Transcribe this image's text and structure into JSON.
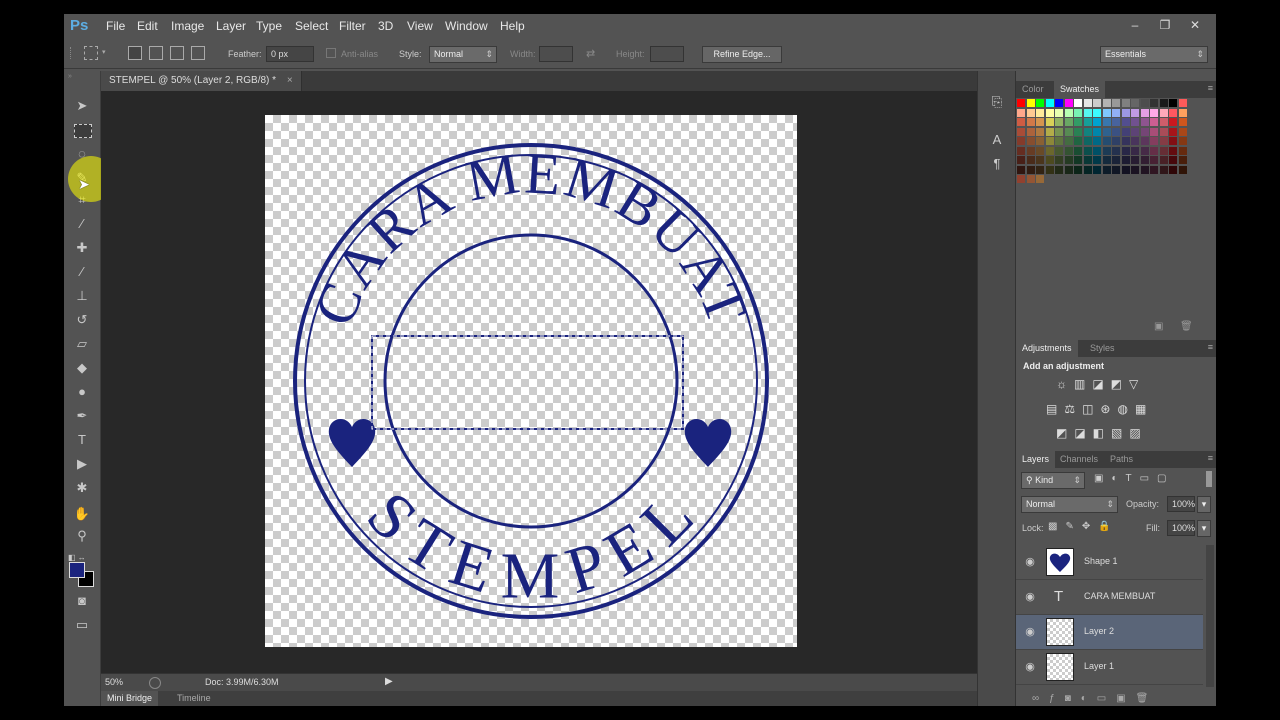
{
  "app": {
    "logo": "Ps"
  },
  "menu": [
    "File",
    "Edit",
    "Image",
    "Layer",
    "Type",
    "Select",
    "Filter",
    "3D",
    "View",
    "Window",
    "Help"
  ],
  "window_controls": {
    "minimize": "–",
    "restore": "❐",
    "close": "✕"
  },
  "options": {
    "feather_label": "Feather:",
    "feather_value": "0 px",
    "antialias_label": "Anti-alias",
    "style_label": "Style:",
    "style_value": "Normal",
    "width_label": "Width:",
    "height_label": "Height:",
    "refine_edge": "Refine Edge...",
    "workspace": "Essentials"
  },
  "document": {
    "tab_title": "STEMPEL @ 50% (Layer 2, RGB/8) *",
    "close": "×",
    "zoom": "50%",
    "doc_size": "Doc: 3.99M/6.30M"
  },
  "stamp": {
    "top_text": "CARA MEMBUAT",
    "bottom_text": "STEMPEL",
    "color": "#1a237e"
  },
  "bottom_tabs": [
    "Mini Bridge",
    "Timeline"
  ],
  "color_panel": {
    "tabs": [
      "Color",
      "Swatches"
    ],
    "active": "Swatches"
  },
  "adjustments_panel": {
    "tabs": [
      "Adjustments",
      "Styles"
    ],
    "active": "Adjustments",
    "heading": "Add an adjustment"
  },
  "layers_panel": {
    "tabs": [
      "Layers",
      "Channels",
      "Paths"
    ],
    "active": "Layers",
    "filter": "Kind",
    "blend_mode": "Normal",
    "opacity_label": "Opacity:",
    "opacity": "100%",
    "lock_label": "Lock:",
    "fill_label": "Fill:",
    "fill": "100%",
    "layers": [
      {
        "name": "Shape 1",
        "kind": "shape",
        "selected": false
      },
      {
        "name": "CARA MEMBUAT",
        "kind": "text",
        "selected": false
      },
      {
        "name": "Layer 2",
        "kind": "pixel",
        "selected": true
      },
      {
        "name": "Layer 1",
        "kind": "pixel",
        "selected": false
      }
    ]
  },
  "colors": {
    "foreground": "#1a237e",
    "background": "#000000",
    "selected_layer": "#5a6578"
  }
}
